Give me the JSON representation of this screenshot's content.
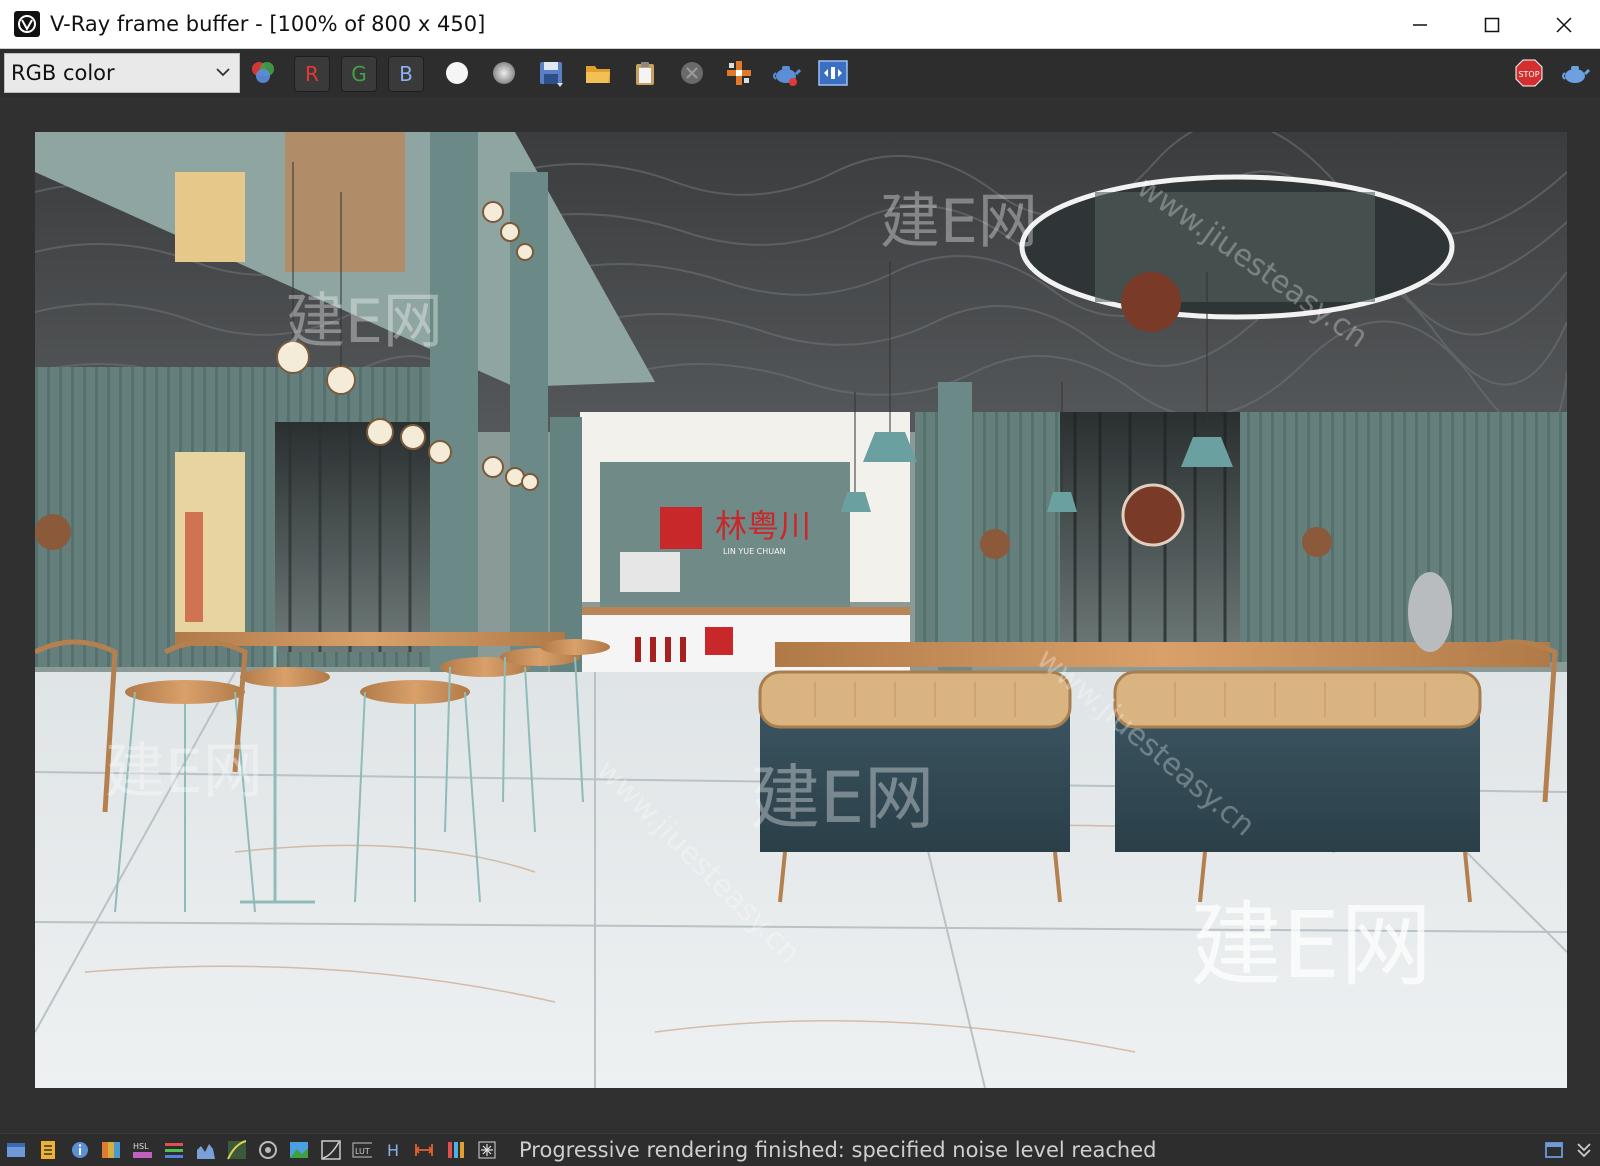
{
  "window": {
    "title": "V-Ray frame buffer - [100% of 800 x 450]"
  },
  "toolbar": {
    "channel_select": "RGB color",
    "red_label": "R",
    "green_label": "G",
    "blue_label": "B",
    "stop_label": "STOP",
    "lut_label": "LUT"
  },
  "render": {
    "signage": "林粤川",
    "signage_sub": "LIN YUE CHUAN",
    "watermark_1": "建E网",
    "watermark_2": "建E网",
    "watermark_3": "建E网",
    "watermark_4": "建E网",
    "watermark_5": "建E网",
    "watermark_url": "www.jiuesteasy.cn"
  },
  "statusbar": {
    "message": "Progressive rendering finished: specified noise level reached",
    "hsl_label": "HSL",
    "h_label": "H"
  },
  "colors": {
    "titlebar_bg": "#ffffff",
    "toolbar_bg": "#2d2d2d",
    "viewport_bg": "#303030",
    "channel_red": "#e53935",
    "channel_green": "#43a047",
    "channel_blue": "#5c8de0",
    "stop_red": "#d32f2f"
  }
}
